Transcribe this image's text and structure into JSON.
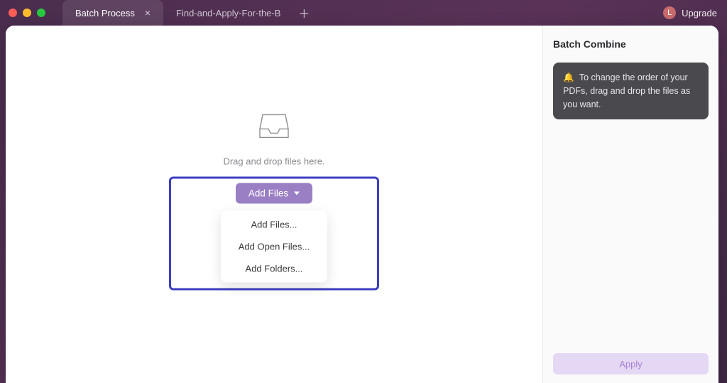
{
  "tabs": [
    {
      "label": "Batch Process",
      "active": true
    },
    {
      "label": "Find-and-Apply-For-the-B",
      "active": false
    }
  ],
  "upgrade": {
    "avatar_letter": "L",
    "label": "Upgrade"
  },
  "main": {
    "dropzone_text": "Drag and drop files here.",
    "add_files_button": "Add Files",
    "dropdown": [
      "Add Files...",
      "Add Open Files...",
      "Add Folders..."
    ]
  },
  "sidebar": {
    "title": "Batch Combine",
    "tip_emoji": "🔔",
    "tip_text": "To change the order of your PDFs, drag and drop the files as you want.",
    "apply_label": "Apply"
  }
}
